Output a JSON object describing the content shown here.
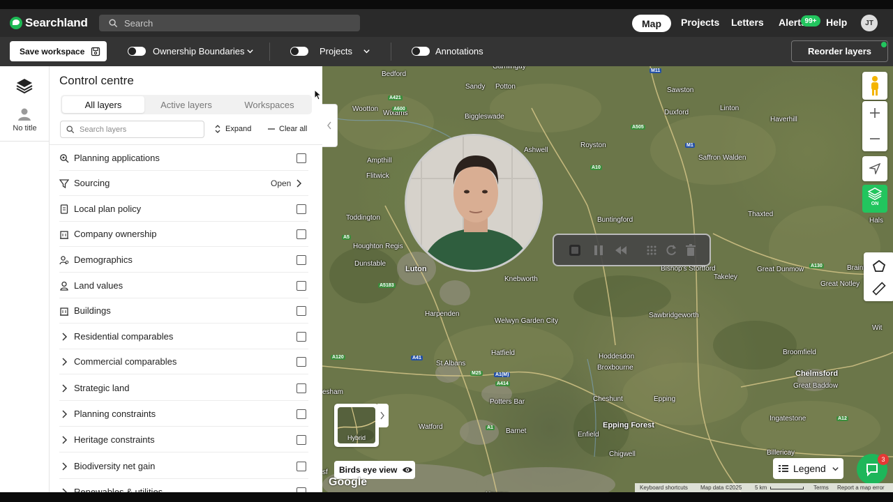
{
  "app": {
    "name": "Searchland"
  },
  "topnav": {
    "search_placeholder": "Search",
    "links": {
      "map": "Map",
      "projects": "Projects",
      "letters": "Letters",
      "alerts": "Alerts",
      "help": "Help"
    },
    "alerts_badge": "99+",
    "avatar_initials": "JT"
  },
  "toolbar": {
    "save_workspace": "Save workspace",
    "ownership_boundaries": "Ownership Boundaries",
    "projects": "Projects",
    "annotations": "Annotations",
    "reorder_layers": "Reorder layers"
  },
  "rail": {
    "no_title": "No title"
  },
  "panel": {
    "title": "Control centre",
    "tabs": [
      "All layers",
      "Active layers",
      "Workspaces"
    ],
    "active_tab": "All layers",
    "search_placeholder": "Search layers",
    "expand": "Expand",
    "clear_all": "Clear all",
    "layers": [
      {
        "label": "Planning applications",
        "icon": "magnifier-icon",
        "control": "checkbox"
      },
      {
        "label": "Sourcing",
        "icon": "funnel-icon",
        "control": "open",
        "open_label": "Open"
      },
      {
        "label": "Local plan policy",
        "icon": "document-icon",
        "control": "checkbox"
      },
      {
        "label": "Company ownership",
        "icon": "building-icon",
        "control": "checkbox"
      },
      {
        "label": "Demographics",
        "icon": "person-search-icon",
        "control": "checkbox"
      },
      {
        "label": "Land values",
        "icon": "person-pin-icon",
        "control": "checkbox"
      },
      {
        "label": "Buildings",
        "icon": "building-icon",
        "control": "checkbox"
      },
      {
        "label": "Residential comparables",
        "icon": "chevron-right-icon",
        "control": "checkbox"
      },
      {
        "label": "Commercial comparables",
        "icon": "chevron-right-icon",
        "control": "checkbox"
      },
      {
        "label": "Strategic land",
        "icon": "chevron-right-icon",
        "control": "checkbox"
      },
      {
        "label": "Planning constraints",
        "icon": "chevron-right-icon",
        "control": "checkbox"
      },
      {
        "label": "Heritage constraints",
        "icon": "chevron-right-icon",
        "control": "checkbox"
      },
      {
        "label": "Biodiversity net gain",
        "icon": "chevron-right-icon",
        "control": "checkbox"
      },
      {
        "label": "Renewables & utilities",
        "icon": "chevron-right-icon",
        "control": "checkbox"
      }
    ]
  },
  "map": {
    "towns": [
      "Bedford",
      "Sandy",
      "Potton",
      "Sawston",
      "Linton",
      "Wootton",
      "Wixams",
      "Biggleswade",
      "Duxford",
      "Haverhill",
      "Ashwell",
      "Royston",
      "Saffron Walden",
      "Ampthill",
      "Flitwick",
      "Toddington",
      "Buntingford",
      "Thaxted",
      "Houghton Regis",
      "Dunstable",
      "Luton",
      "Knebworth",
      "Bishop's Stortford",
      "Takeley",
      "Great Dunmow",
      "Braintree",
      "Great Notley",
      "Harpenden",
      "Welwyn Garden City",
      "Sawbridgeworth",
      "St Albans",
      "Hatfield",
      "Hoddesdon",
      "Broxbourne",
      "Broomfield",
      "Chelmsford",
      "Great Baddow",
      "Potters Bar",
      "Cheshunt",
      "Epping",
      "Epping Forest",
      "Watford",
      "Barnet",
      "Enfield",
      "Ingatestone",
      "Billericay",
      "Chigwell",
      "Harrow",
      "Gamlingay",
      "Hals",
      "Wit",
      "esham",
      "sf"
    ],
    "map_type": "Hybrid",
    "birds_eye_view": "Birds eye view",
    "legend": "Legend",
    "google": "Google",
    "attribution": {
      "shortcuts": "Keyboard shortcuts",
      "data": "Map data ©2025",
      "scale": "5 km",
      "terms": "Terms",
      "report": "Report a map error"
    },
    "layers_toggle": "ON",
    "chat_badge": "3",
    "roads": [
      "M11",
      "A421",
      "A600",
      "A505",
      "A10",
      "M1",
      "A5",
      "A5183",
      "A1(M)",
      "A414",
      "M25",
      "A41",
      "A120",
      "A130",
      "A12",
      "A1"
    ]
  },
  "colors": {
    "brand": "#22c55e",
    "nav_bg": "#2a2a2a",
    "toolbar_bg": "#343434"
  }
}
